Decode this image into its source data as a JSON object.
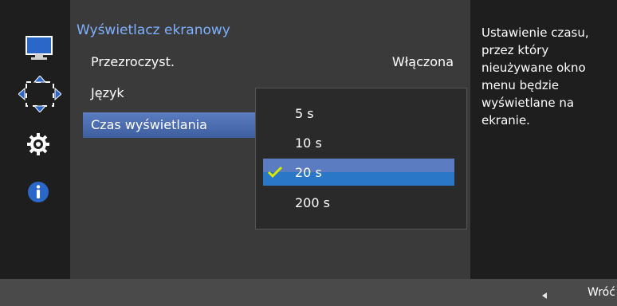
{
  "menu": {
    "title": "Wyświetlacz ekranowy",
    "rows": [
      {
        "label": "Przezroczyst.",
        "value": "Włączona"
      },
      {
        "label": "Język"
      },
      {
        "label": "Czas wyświetlania"
      }
    ]
  },
  "popup": {
    "options": [
      "5 s",
      "10 s",
      "20 s",
      "200 s"
    ],
    "selected": "20 s"
  },
  "help": {
    "text": "Ustawienie czasu, przez który nieużywane okno menu będzie wyświetlane na ekranie."
  },
  "footer": {
    "back_label": "Wróć"
  },
  "sidebar": {
    "icons": [
      "monitor-icon",
      "position-arrows-icon",
      "gear-icon",
      "info-icon"
    ]
  },
  "colors": {
    "accent": "#2a76c7",
    "title": "#7fb0ff",
    "check": "#d7e900"
  }
}
